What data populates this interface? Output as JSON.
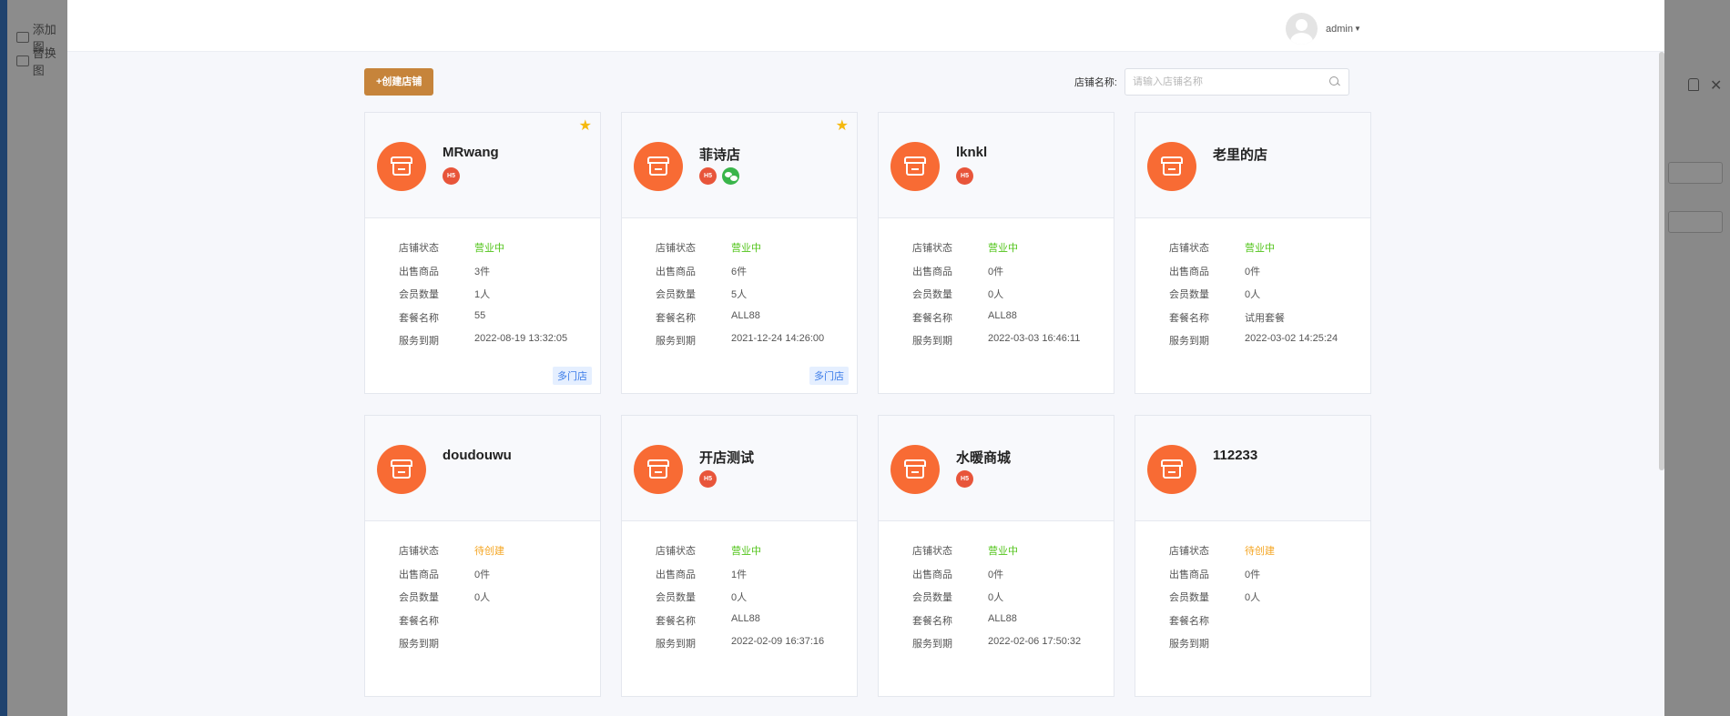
{
  "background": {
    "left_items": [
      "添加图",
      "替换图"
    ]
  },
  "header": {
    "username": "admin"
  },
  "toolbar": {
    "create_label": "+创建店铺",
    "search_label": "店铺名称:",
    "search_placeholder": "请输入店铺名称"
  },
  "field_labels": {
    "status": "店铺状态",
    "goods": "出售商品",
    "members": "会员数量",
    "package": "套餐名称",
    "expire": "服务到期"
  },
  "multi_store_label": "多门店",
  "stores": [
    {
      "name": "MRwang",
      "starred": true,
      "h5": true,
      "wechat": false,
      "status": "营业中",
      "status_type": "open",
      "goods": "3件",
      "members": "1人",
      "package": "55",
      "expire": "2022-08-19 13:32:05",
      "multi_store": true
    },
    {
      "name": "菲诗店",
      "starred": true,
      "h5": true,
      "wechat": true,
      "status": "营业中",
      "status_type": "open",
      "goods": "6件",
      "members": "5人",
      "package": "ALL88",
      "expire": "2021-12-24 14:26:00",
      "multi_store": true
    },
    {
      "name": "lknkl",
      "starred": false,
      "h5": true,
      "wechat": false,
      "status": "营业中",
      "status_type": "open",
      "goods": "0件",
      "members": "0人",
      "package": "ALL88",
      "expire": "2022-03-03 16:46:11",
      "multi_store": false
    },
    {
      "name": "老里的店",
      "starred": false,
      "h5": false,
      "wechat": false,
      "status": "营业中",
      "status_type": "open",
      "goods": "0件",
      "members": "0人",
      "package": "试用套餐",
      "expire": "2022-03-02 14:25:24",
      "multi_store": false
    },
    {
      "name": "doudouwu",
      "starred": false,
      "h5": false,
      "wechat": false,
      "status": "待创建",
      "status_type": "pending",
      "goods": "0件",
      "members": "0人",
      "package": "",
      "expire": "",
      "multi_store": false
    },
    {
      "name": "开店测试",
      "starred": false,
      "h5": true,
      "wechat": false,
      "status": "营业中",
      "status_type": "open",
      "goods": "1件",
      "members": "0人",
      "package": "ALL88",
      "expire": "2022-02-09 16:37:16",
      "multi_store": false
    },
    {
      "name": "水暖商城",
      "starred": false,
      "h5": true,
      "wechat": false,
      "status": "营业中",
      "status_type": "open",
      "goods": "0件",
      "members": "0人",
      "package": "ALL88",
      "expire": "2022-02-06 17:50:32",
      "multi_store": false
    },
    {
      "name": "112233",
      "starred": false,
      "h5": false,
      "wechat": false,
      "status": "待创建",
      "status_type": "pending",
      "goods": "0件",
      "members": "0人",
      "package": "",
      "expire": "",
      "multi_store": false
    }
  ],
  "colors": {
    "accent_button": "#c6843b",
    "store_avatar": "#f86b34",
    "status_open": "#52c41a",
    "status_pending": "#f5a623",
    "star": "#f5b90f"
  }
}
